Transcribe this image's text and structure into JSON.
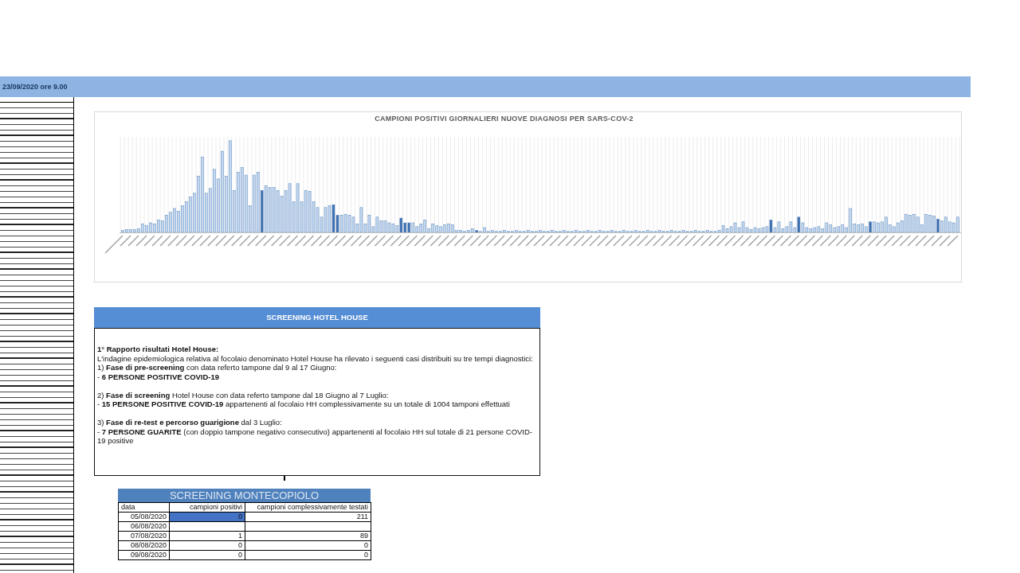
{
  "header_bar": {
    "text": "23/09/2020 ore 9.00"
  },
  "chart": {
    "title": "CAMPIONI POSITIVI GIORNALIERI NUOVE DIAGNOSI PER SARS-COV-2"
  },
  "hotel_house": {
    "title": "SCREENING HOTEL HOUSE",
    "paragraphs": [
      {
        "lines": [
          {
            "kind": "heading",
            "text": "1° Rapporto  risultati Hotel House:"
          },
          {
            "kind": "text",
            "text": "L'indagine epidemiologica relativa al focolaio denominato Hotel House ha rilevato i seguenti casi distribuiti su tre tempi diagnostici:"
          },
          {
            "kind": "text",
            "text": "1) **Fase di pre-screening** con data referto tampone dal 9 al 17 Giugno:"
          },
          {
            "kind": "result",
            "text": "- **6 PERSONE POSITIVE COVID-19**"
          }
        ]
      },
      {
        "lines": [
          {
            "kind": "text",
            "text": "2) **Fase di screening** Hotel House con data referto tampone dal 18 Giugno al 7 Luglio:"
          },
          {
            "kind": "result",
            "text": "- **15 PERSONE POSITIVE COVID-19** appartenenti al focolaio HH complessivamente su un totale di 1004 tamponi effettuati"
          }
        ]
      },
      {
        "lines": [
          {
            "kind": "text",
            "text": "3) **Fase di re-test e percorso guarigione** dal 3 Luglio:"
          },
          {
            "kind": "result",
            "text": "- **7 PERSONE GUARITE** (con doppio tampone negativo consecutivo) appartenenti al focolaio HH sul totale di 21 persone COVID-19 positive"
          }
        ]
      }
    ]
  },
  "montecopiolo": {
    "title": "SCREENING MONTECOPIOLO",
    "columns": [
      "data",
      "campioni positivi",
      "campioni complessivamente testati"
    ],
    "rows": [
      {
        "cells": [
          {
            "text": "05/08/2020",
            "selected": false
          },
          {
            "text": "0",
            "selected": true
          },
          {
            "text": "211",
            "selected": false
          }
        ]
      },
      {
        "cells": [
          {
            "text": "06/08/2020",
            "selected": false
          },
          {
            "selected": false
          },
          {
            "selected": false
          }
        ]
      },
      {
        "cells": [
          {
            "text": "07/08/2020",
            "selected": false
          },
          {
            "text": "1",
            "selected": false
          },
          {
            "text": "89",
            "selected": false
          }
        ]
      },
      {
        "cells": [
          {
            "text": "08/08/2020",
            "selected": false
          },
          {
            "text": "0",
            "selected": false
          },
          {
            "text": "0",
            "selected": false
          }
        ]
      },
      {
        "cells": [
          {
            "text": "09/08/2020",
            "selected": false
          },
          {
            "text": "0",
            "selected": false
          },
          {
            "text": "0",
            "selected": false
          }
        ]
      }
    ]
  }
}
